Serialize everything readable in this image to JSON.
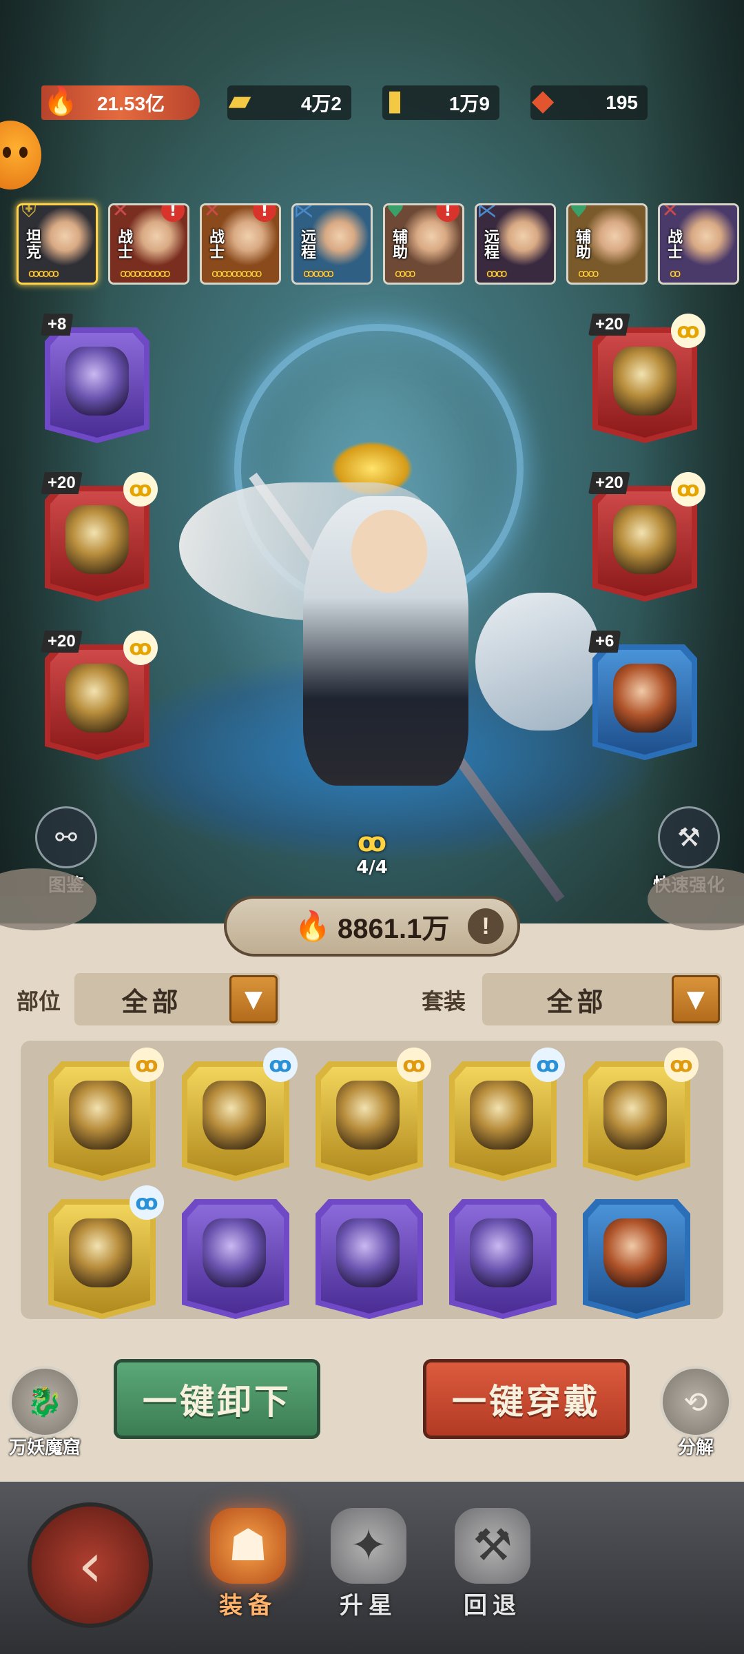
{
  "resources": {
    "combat_power": "21.53亿",
    "gold": "4万2",
    "scroll": "1万9",
    "crystal": "195"
  },
  "heroes": [
    {
      "role": "坦克",
      "stars": "ꝏꝏꝏ",
      "selected": true
    },
    {
      "role": "战士",
      "stars": "ꝏꝏꝏꝏꝏ",
      "alert": "!"
    },
    {
      "role": "战士",
      "stars": "ꝏꝏꝏꝏꝏ",
      "alert": "!"
    },
    {
      "role": "远程",
      "stars": "ꝏꝏꝏ"
    },
    {
      "role": "辅助",
      "stars": "ꝏꝏ",
      "alert": "!"
    },
    {
      "role": "远程",
      "stars": "ꝏꝏ"
    },
    {
      "role": "辅助",
      "stars": "ꝏꝏ"
    },
    {
      "role": "战士",
      "stars": "ꝏ"
    }
  ],
  "equipped": {
    "left": [
      {
        "level": "+8",
        "quality": "purple"
      },
      {
        "level": "+20",
        "quality": "red"
      },
      {
        "level": "+20",
        "quality": "red"
      }
    ],
    "right": [
      {
        "level": "+20",
        "quality": "red"
      },
      {
        "level": "+20",
        "quality": "red"
      },
      {
        "level": "+6",
        "quality": "blue"
      }
    ]
  },
  "set_count": "4/4",
  "side_buttons": {
    "codex": "图鉴",
    "quick_enhance": "快速强化"
  },
  "equipment_power": "8861.1万",
  "filters": {
    "slot_label": "部位",
    "slot_value": "全部",
    "set_label": "套装",
    "set_value": "全部"
  },
  "inventory_qualities": [
    "gold",
    "gold",
    "gold",
    "gold",
    "gold",
    "gold",
    "purple",
    "purple",
    "purple",
    "blue"
  ],
  "actions": {
    "unequip_all": "一键卸下",
    "equip_all": "一键穿戴",
    "demon_cave": "万妖魔窟",
    "decompose": "分解"
  },
  "nav": {
    "equip": "装备",
    "star_up": "升星",
    "revert": "回退"
  },
  "colors": {
    "accent_red": "#b02a2a",
    "accent_gold": "#d9b53d",
    "panel": "#e3d8c7"
  }
}
